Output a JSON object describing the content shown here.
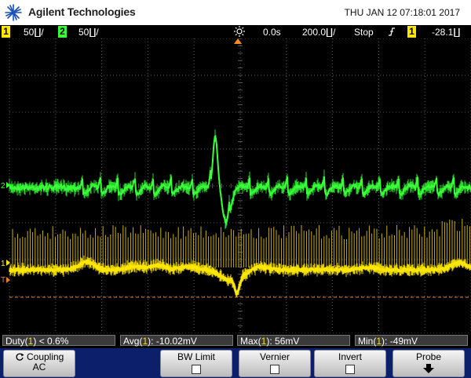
{
  "header": {
    "brand": "Agilent Technologies",
    "datetime": "THU JAN 12 07:18:01 2017"
  },
  "status": {
    "ch1_marker": "1",
    "ch1_scale": "50∐/",
    "ch2_marker": "2",
    "ch2_scale": "50∐/",
    "trigger_icon": "trigger-position-icon",
    "time_delay": "0.0s",
    "time_scale": "200.0∐/",
    "run_state": "Stop",
    "trigger_slope_icon": "rising-edge-icon",
    "trigger_source": "1",
    "trigger_level": "-28.1∐"
  },
  "screen": {
    "markers": {
      "ch2": "2",
      "ch1": "1",
      "trigger": "T"
    },
    "colors": {
      "ch1": "#ffe800",
      "ch2": "#3cff3c",
      "grid": "#5a5a5a",
      "trigger_level": "#e0802a"
    }
  },
  "measurements": {
    "duty": {
      "pre": "Duty(",
      "ch": "1",
      "post": ") < 0.6%"
    },
    "avg": {
      "pre": "Avg(",
      "ch": "1",
      "post": "): -10.02mV"
    },
    "max": {
      "pre": "Max(",
      "ch": "1",
      "post": "): 56mV"
    },
    "min": {
      "pre": "Min(",
      "ch": "1",
      "post": "): -49mV"
    }
  },
  "softkeys": {
    "coupling_label": "Coupling",
    "coupling_value": "AC",
    "coupling_icon": "rotate-knob-icon",
    "bwlimit_label": "BW Limit",
    "vernier_label": "Vernier",
    "invert_label": "Invert",
    "probe_label": "Probe",
    "probe_icon": "down-arrow-icon"
  }
}
